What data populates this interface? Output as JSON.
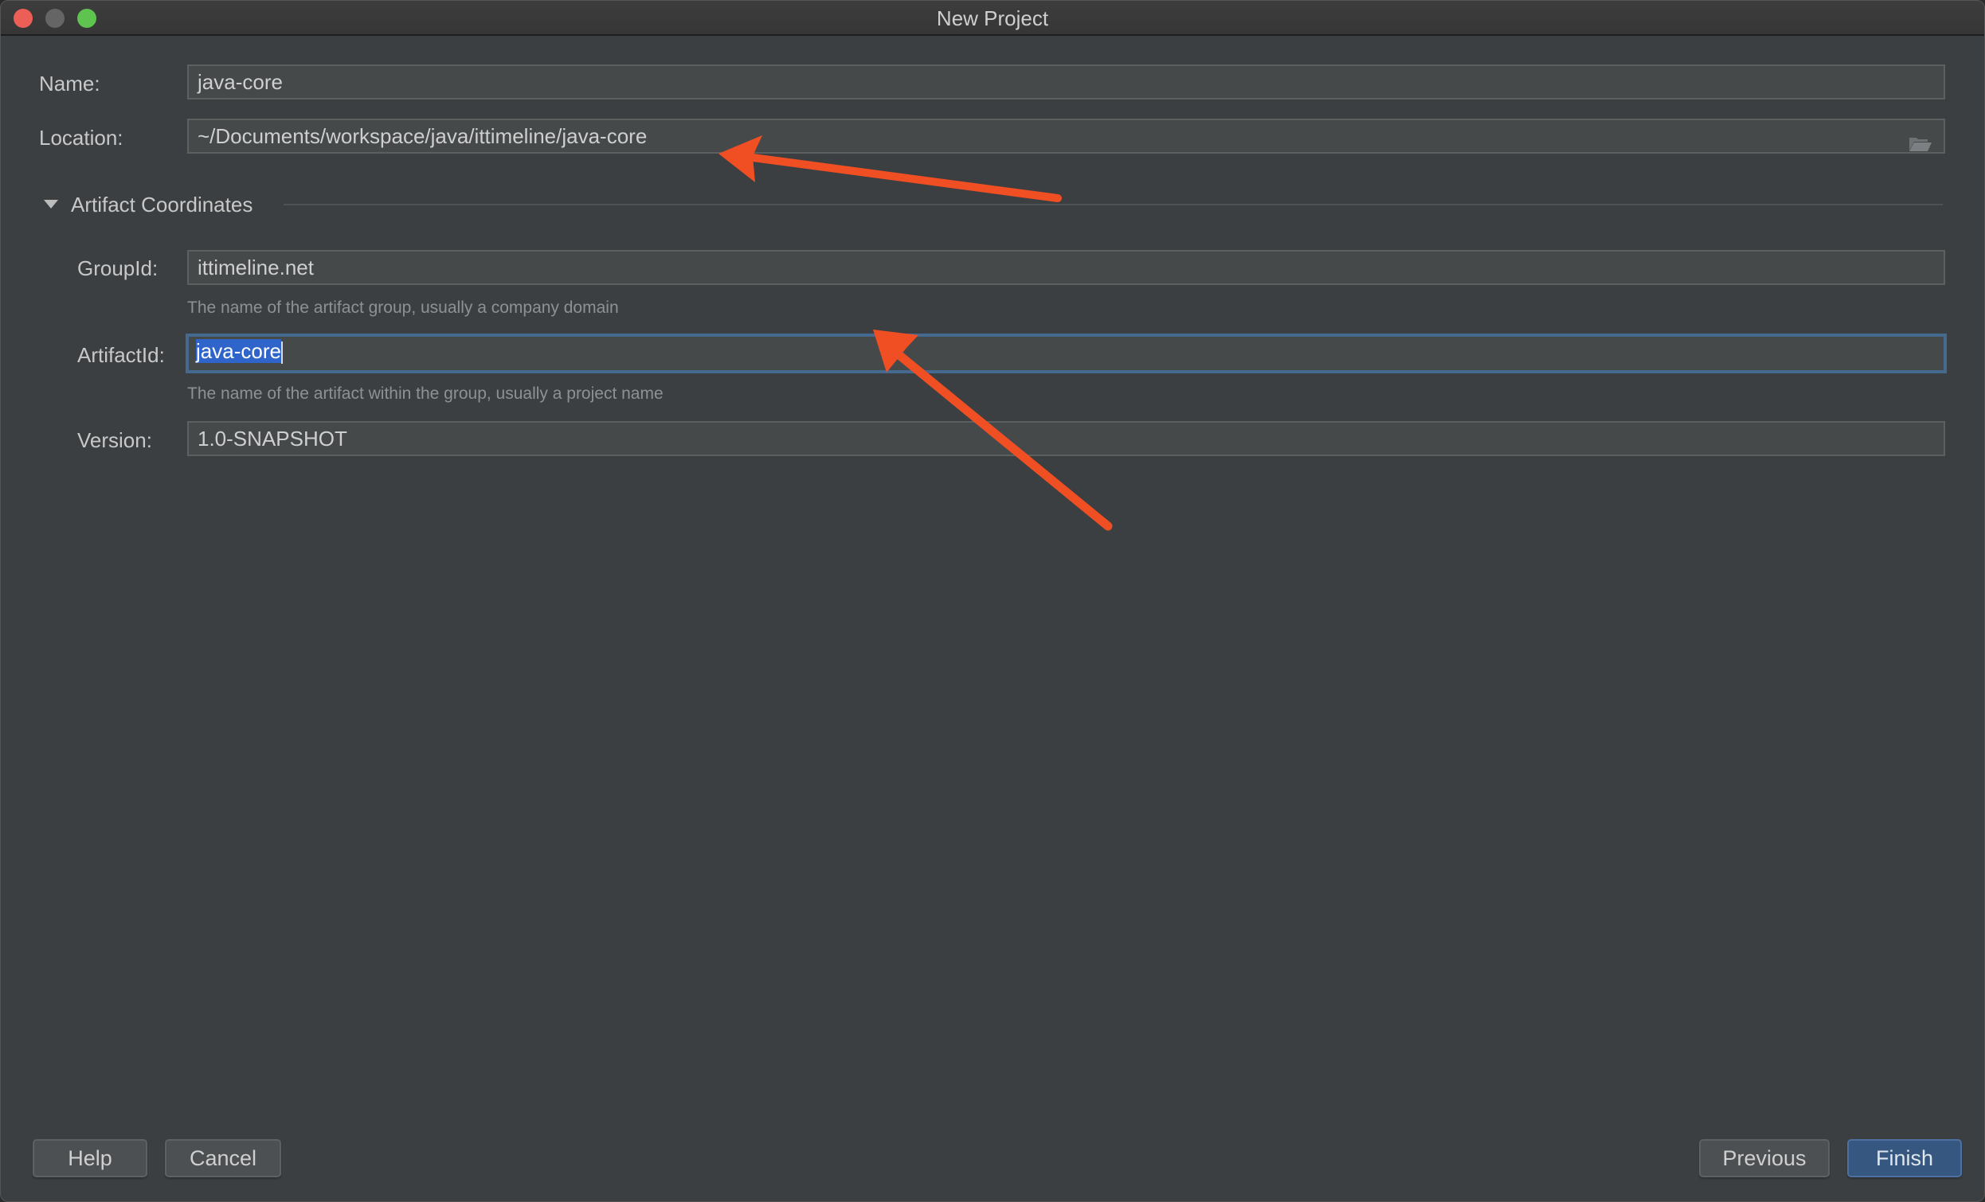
{
  "window": {
    "title": "New Project",
    "controls": {
      "close": "close-window",
      "minimize": "minimize-window",
      "maximize": "maximize-window"
    }
  },
  "form": {
    "name": {
      "label": "Name:",
      "value": "java-core"
    },
    "location": {
      "label": "Location:",
      "value": "~/Documents/workspace/java/ittimeline/java-core",
      "icon": "folder-open-icon"
    },
    "section": {
      "title": "Artifact Coordinates",
      "expanded": true,
      "icon": "triangle-down-icon"
    },
    "group_id": {
      "label": "GroupId:",
      "value": "ittimeline.net",
      "hint": "The name of the artifact group, usually a company domain"
    },
    "artifact_id": {
      "label": "ArtifactId:",
      "value": "java-core",
      "selected_text": "java-core",
      "focused": true,
      "hint": "The name of the artifact within the group, usually a project name"
    },
    "version": {
      "label": "Version:",
      "value": "1.0-SNAPSHOT"
    }
  },
  "buttons": {
    "help": "Help",
    "cancel": "Cancel",
    "previous": "Previous",
    "finish": "Finish"
  },
  "colors": {
    "background": "#3c3f41",
    "field_bg": "#45494a",
    "focus_border": "#46698f",
    "selection": "#2f65ca",
    "primary_button": "#365880",
    "annotation_arrow": "#f04e23"
  },
  "annotations": [
    {
      "type": "arrow",
      "points_to": "location-field"
    },
    {
      "type": "arrow",
      "points_to": "artifactid-field"
    }
  ]
}
